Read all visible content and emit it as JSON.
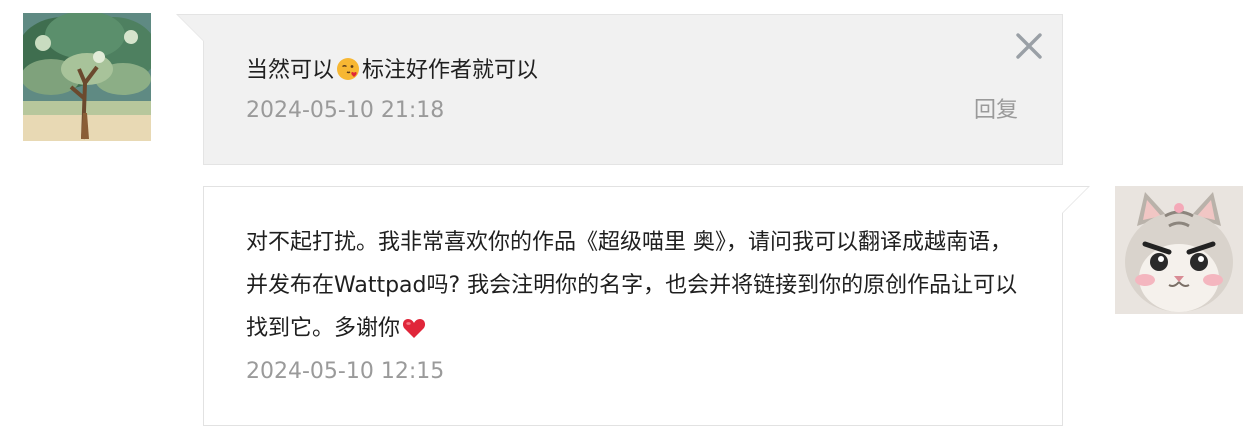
{
  "conversation": {
    "received": {
      "text_before": "当然可以",
      "emoji": "blowing-kiss-face-emoji",
      "text_after": "标注好作者就可以",
      "timestamp": "2024-05-10 21:18",
      "reply_label": "回复",
      "close_icon": "close-icon"
    },
    "sent": {
      "text": "对不起打扰。我非常喜欢你的作品《超级喵里 奥》，请问我可以翻译成越南语，并发布在Wattpad吗? 我会注明你的名字，也会并将链接到你的原创作品让可以找到它。多谢你",
      "emoji": "red-heart-emoji",
      "timestamp": "2024-05-10 12:15"
    }
  },
  "colors": {
    "received_bubble": "#f1f1f1",
    "text": "#1f1f1f",
    "muted": "#9a9a9a",
    "heart": "#e0263a"
  }
}
